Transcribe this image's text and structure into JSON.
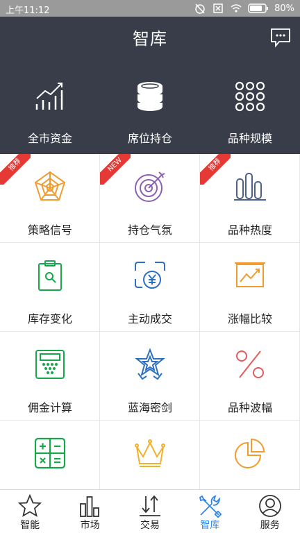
{
  "status_bar": {
    "time": "上午11:12",
    "battery": "80%"
  },
  "header": {
    "title": "智库"
  },
  "quick_links": [
    {
      "label": "全市资金",
      "icon": "trend-chart-icon"
    },
    {
      "label": "席位持仓",
      "icon": "coin-stack-icon"
    },
    {
      "label": "品种规模",
      "icon": "dots-grid-icon"
    }
  ],
  "tiles": [
    {
      "label": "策略信号",
      "badge": "推荐",
      "icon": "pentagon-radar-icon"
    },
    {
      "label": "持仓气氛",
      "badge": "NEW",
      "icon": "target-dart-icon"
    },
    {
      "label": "品种热度",
      "badge": "推荐",
      "icon": "bar-columns-icon"
    },
    {
      "label": "库存变化",
      "icon": "clipboard-search-icon"
    },
    {
      "label": "主动成交",
      "icon": "yen-exchange-icon"
    },
    {
      "label": "涨幅比较",
      "icon": "line-chart-board-icon"
    },
    {
      "label": "佣金计算",
      "icon": "calculator-icon"
    },
    {
      "label": "蓝海密剑",
      "icon": "star-badge-icon"
    },
    {
      "label": "品种波幅",
      "icon": "percent-icon"
    },
    {
      "label": "",
      "icon": "calc-keys-icon"
    },
    {
      "label": "",
      "icon": "crown-icon"
    },
    {
      "label": "",
      "icon": "pie-chart-icon"
    }
  ],
  "tabs": [
    {
      "label": "智能",
      "icon": "star-icon",
      "active": false
    },
    {
      "label": "市场",
      "icon": "bars-icon",
      "active": false
    },
    {
      "label": "交易",
      "icon": "transfer-arrows-icon",
      "active": false
    },
    {
      "label": "智库",
      "icon": "tools-icon",
      "active": true
    },
    {
      "label": "服务",
      "icon": "user-icon",
      "active": false
    }
  ],
  "colors": {
    "header_bg": "#383d49",
    "status_bg": "#9a9a9a",
    "ribbon": "#e53935",
    "active_tab": "#2f86e6",
    "orange": "#f29b2e",
    "purple": "#8c5fb1",
    "navy": "#4d5f8a",
    "green": "#18a64a",
    "blue": "#2c6fbf",
    "red": "#e35b5b",
    "gold": "#f2b12a"
  }
}
